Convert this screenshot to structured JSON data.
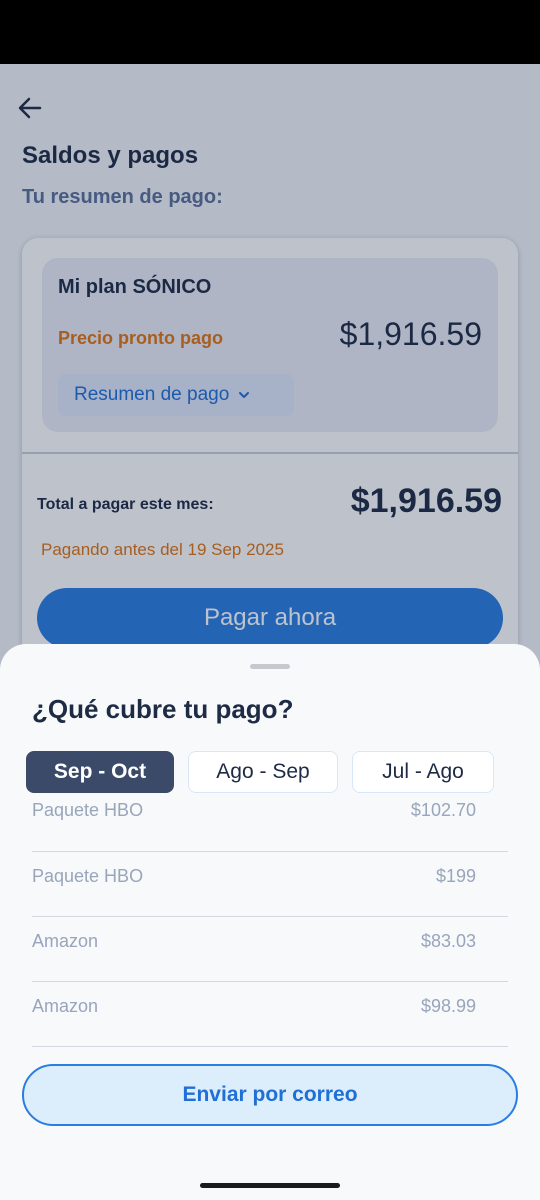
{
  "header": {
    "title": "Saldos y pagos",
    "subtitle": "Tu resumen de pago:"
  },
  "plan": {
    "name": "Mi plan SÓNICO",
    "price_label": "Precio pronto pago",
    "price": "$1,916.59",
    "summary_label": "Resumen de pago"
  },
  "total": {
    "label": "Total a pagar este mes:",
    "amount": "$1,916.59",
    "due_note": "Pagando antes del 19 Sep 2025",
    "pay_button": "Pagar ahora"
  },
  "sheet": {
    "title": "¿Qué cubre tu pago?",
    "tabs": [
      {
        "label": "Sep - Oct",
        "active": true
      },
      {
        "label": "Ago - Sep",
        "active": false
      },
      {
        "label": "Jul - Ago",
        "active": false
      }
    ],
    "items": [
      {
        "name": "Paquete HBO",
        "amount": "$102.70"
      },
      {
        "name": "Paquete HBO",
        "amount": "$199"
      },
      {
        "name": "Amazon",
        "amount": "$83.03"
      },
      {
        "name": "Amazon",
        "amount": "$98.99"
      }
    ],
    "email_button": "Enviar por correo"
  },
  "icons": {
    "back": "arrow-left-icon",
    "chevron": "chevron-down-icon"
  },
  "colors": {
    "accent": "#2a7de1",
    "warning": "#e07512",
    "text_dark": "#1e2b44",
    "tab_active": "#3b4a68"
  }
}
